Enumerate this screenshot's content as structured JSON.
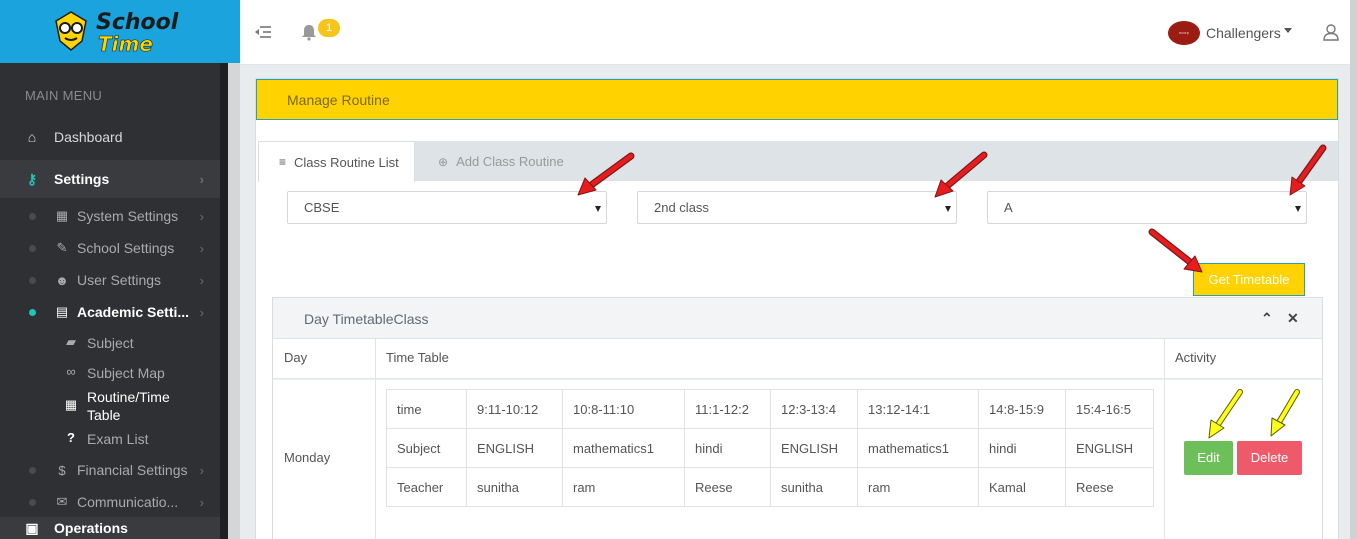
{
  "app": {
    "logo_line1": "School",
    "logo_line2": "Time",
    "brand_color": "#1aa3dd",
    "accent_color": "#ffd200"
  },
  "sidebar": {
    "section_label": "MAIN MENU",
    "dashboard_label": "Dashboard",
    "settings_label": "Settings",
    "settings_items": [
      {
        "label": "System Settings",
        "icon": "building-icon"
      },
      {
        "label": "School Settings",
        "icon": "wrench-icon"
      },
      {
        "label": "User Settings",
        "icon": "users-icon"
      },
      {
        "label": "Academic Setti...",
        "icon": "book-icon"
      },
      {
        "label": "Financial Settings",
        "icon": "dollar-icon"
      },
      {
        "label": "Communicatio...",
        "icon": "envelope-icon"
      }
    ],
    "academic_items": [
      {
        "label": "Subject",
        "icon": "book-icon"
      },
      {
        "label": "Subject Map",
        "icon": "link-icon"
      },
      {
        "label": "Routine/Time Table",
        "line1": "Routine/Time",
        "line2": "Table",
        "icon": "table-icon"
      },
      {
        "label": "Exam List",
        "icon": "question-icon"
      }
    ],
    "operations_label": "Operations"
  },
  "topbar": {
    "notification_count": "1",
    "profile_name": "Challengers",
    "avatar_text": "ecorp"
  },
  "page": {
    "title": "Manage Routine",
    "tabs": [
      {
        "label": "Class Routine List",
        "active": true
      },
      {
        "label": "Add Class Routine",
        "active": false
      }
    ],
    "filters": {
      "board": "CBSE",
      "class": "2nd class",
      "section": "A"
    },
    "get_button": "Get Timetable",
    "timetable_panel_title": "Day TimetableClass",
    "columns": [
      "Day",
      "Time Table",
      "Activity"
    ],
    "rows": [
      {
        "day": "Monday",
        "time_row": [
          "time",
          "9:11-10:12",
          "10:8-11:10",
          "11:1-12:2",
          "12:3-13:4",
          "13:12-14:1",
          "14:8-15:9",
          "15:4-16:5"
        ],
        "subject_row": [
          "Subject",
          "ENGLISH",
          "mathematics1",
          "hindi",
          "ENGLISH",
          "mathematics1",
          "hindi",
          "ENGLISH"
        ],
        "teacher_row": [
          "Teacher",
          "sunitha",
          "ram",
          "Reese",
          "sunitha",
          "ram",
          "Kamal",
          "Reese"
        ],
        "edit_label": "Edit",
        "delete_label": "Delete"
      }
    ]
  }
}
